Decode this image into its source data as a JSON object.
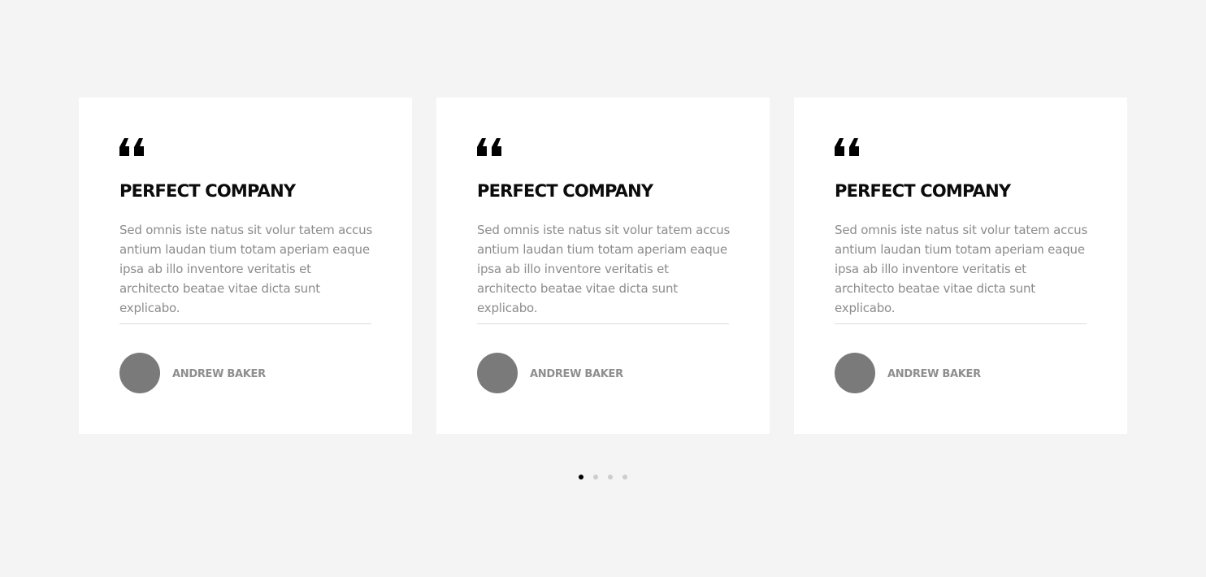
{
  "testimonials": [
    {
      "title": "PERFECT COMPANY",
      "text": "Sed omnis iste natus sit volur tatem accus antium laudan tium totam aperiam eaque ipsa ab illo inventore veritatis et architecto beatae vitae dicta sunt explicabo.",
      "author": "ANDREW BAKER"
    },
    {
      "title": "PERFECT COMPANY",
      "text": "Sed omnis iste natus sit volur tatem accus antium laudan tium totam aperiam eaque ipsa ab illo inventore veritatis et architecto beatae vitae dicta sunt explicabo.",
      "author": "ANDREW BAKER"
    },
    {
      "title": "PERFECT COMPANY",
      "text": "Sed omnis iste natus sit volur tatem accus antium laudan tium totam aperiam eaque ipsa ab illo inventore veritatis et architecto beatae vitae dicta sunt explicabo.",
      "author": "ANDREW BAKER"
    }
  ],
  "pagination": {
    "total": 4,
    "active": 1
  },
  "icons": {
    "quote": "quote-icon"
  },
  "colors": {
    "background": "#f4f4f4",
    "card": "#ffffff",
    "title": "#0b0b0b",
    "text": "#8c8c8c",
    "avatar": "#7a7a7b",
    "dot_active": "#000000",
    "dot_inactive": "#cccccc"
  }
}
